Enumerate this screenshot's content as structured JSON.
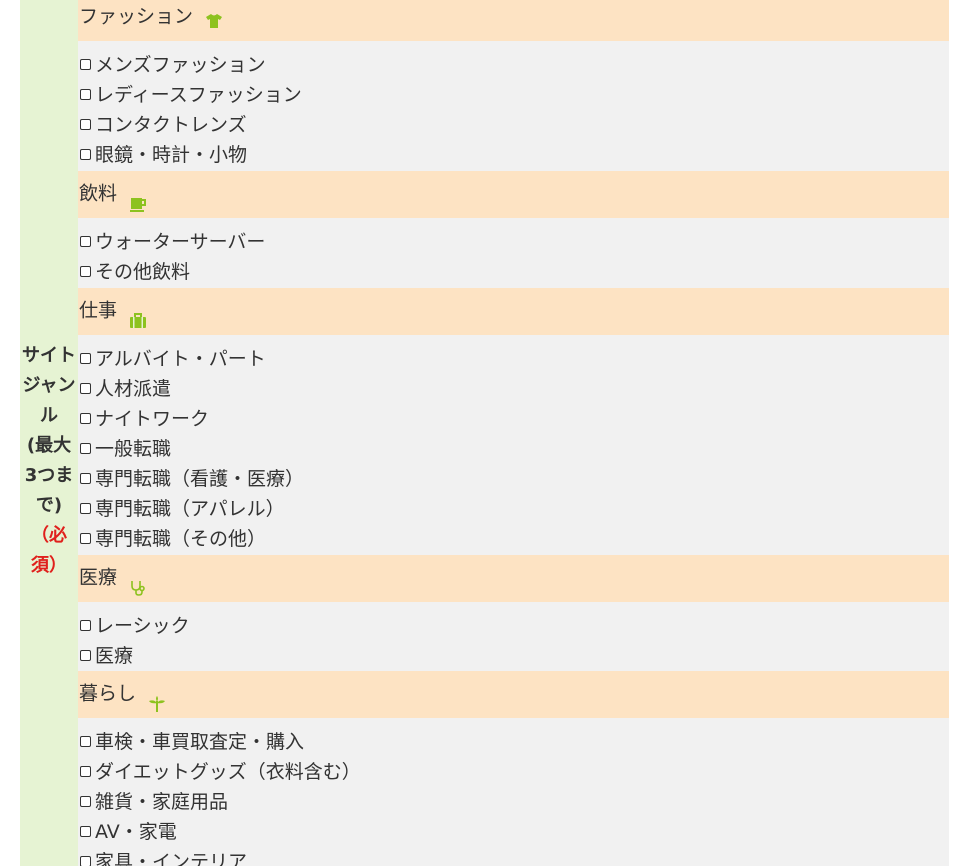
{
  "genre": {
    "label_lines": [
      "サイト",
      "ジャン",
      "ル",
      "(最大",
      "3つま",
      "で)"
    ],
    "required_lines": [
      "（必",
      "須）"
    ]
  },
  "groups": [
    {
      "title": "ファッション",
      "icon": "tshirt-icon",
      "items": [
        "メンズファッション",
        "レディースファッション",
        "コンタクトレンズ",
        "眼鏡・時計・小物"
      ]
    },
    {
      "title": "飲料",
      "icon": "coffee-cup-icon",
      "items": [
        "ウォーターサーバー",
        "その他飲料"
      ]
    },
    {
      "title": "仕事",
      "icon": "briefcase-icon",
      "items": [
        "アルバイト・パート",
        "人材派遣",
        "ナイトワーク",
        "一般転職",
        "専門転職（看護・医療）",
        "専門転職（アパレル）",
        "専門転職（その他）"
      ]
    },
    {
      "title": "医療",
      "icon": "stethoscope-icon",
      "items": [
        "レーシック",
        "医療"
      ]
    },
    {
      "title": "暮らし",
      "icon": "sprout-icon",
      "items": [
        "車検・車買取査定・購入",
        "ダイエットグッズ（衣料含む）",
        "雑貨・家庭用品",
        "AV・家電",
        "家具・インテリア"
      ]
    }
  ],
  "colors": {
    "label_bg": "#e6f3d3",
    "header_bg": "#fde3c3",
    "options_bg": "#f1f1f1",
    "icon_green": "#8dc21f",
    "required_red": "#e0201c"
  }
}
